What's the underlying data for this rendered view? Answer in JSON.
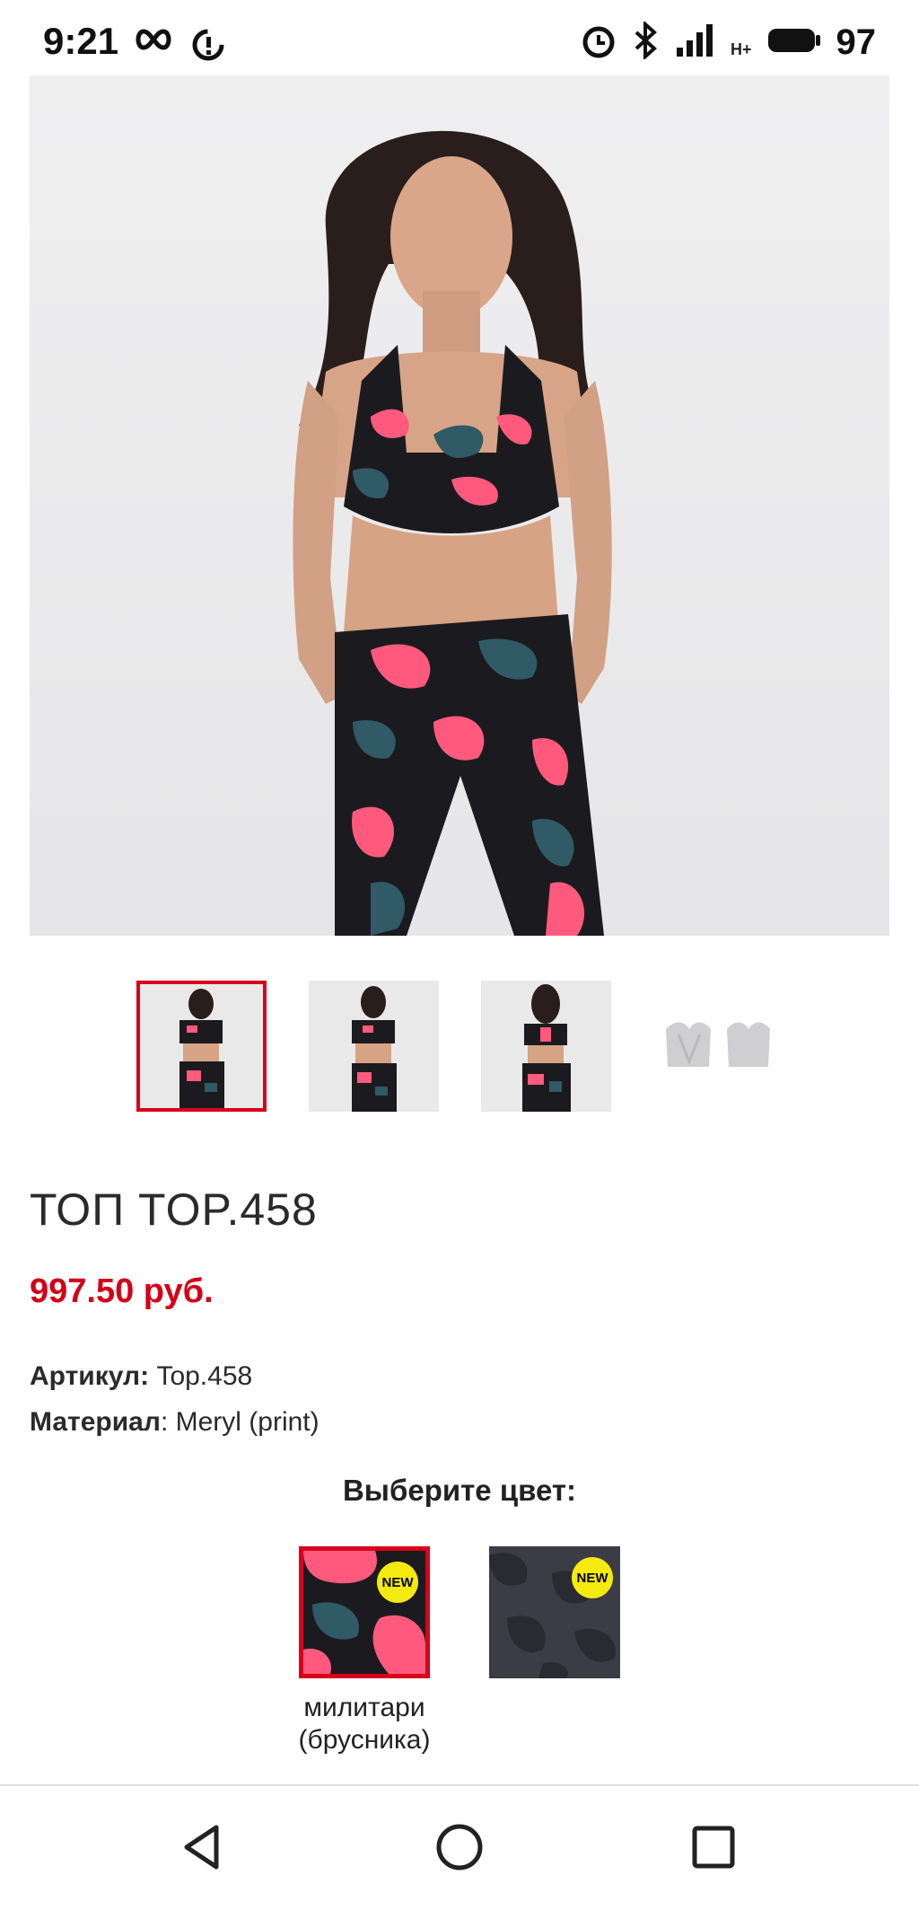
{
  "status_bar": {
    "time": "9:21",
    "battery": "97",
    "network": "H+",
    "icons": [
      "infinity-icon",
      "sync-alert-icon",
      "alarm-icon",
      "bluetooth-icon",
      "signal-icon",
      "battery-icon"
    ]
  },
  "gallery": {
    "main_image": "model-camo-sports-top",
    "thumbnails": [
      "front-view",
      "front-full-view",
      "back-view",
      "product-only-view"
    ],
    "selected_index": 0
  },
  "product": {
    "title": "ТОП TOP.458",
    "price": "997.50 руб.",
    "sku_label": "Артикул:",
    "sku_value": "Top.458",
    "material_label": "Материал",
    "material_value": ": Meryl (print)"
  },
  "colors": {
    "heading": "Выберите цвет:",
    "new_badge": "NEW",
    "selected_name_line1": "милитари",
    "selected_name_line2": "(брусника)",
    "swatches": [
      {
        "id": "camo-pink",
        "selected": true
      },
      {
        "id": "camo-gray",
        "selected": false
      }
    ]
  },
  "colors_accent": {
    "brand_red": "#d40018",
    "badge_yellow": "#f5ea10",
    "camo_pink": "#ff5a7e",
    "camo_teal": "#2f5a66",
    "camo_black": "#1b1b1f"
  },
  "nav": {
    "back": "back-icon",
    "home": "home-icon",
    "recent": "recent-apps-icon"
  }
}
